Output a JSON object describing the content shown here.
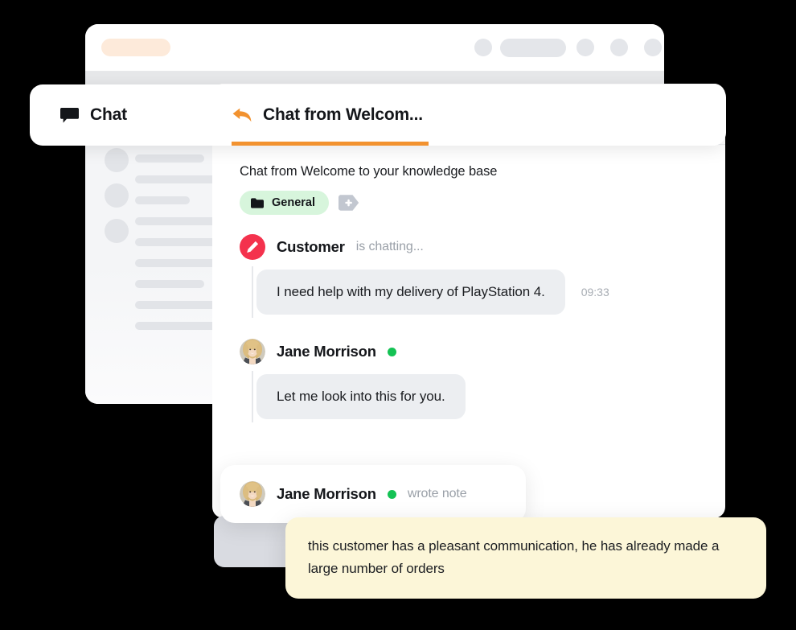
{
  "window": {
    "topbar": {
      "brand_pill": "",
      "nav_dots": [
        "",
        "",
        "",
        ""
      ],
      "nav_pill": ""
    },
    "sidebar": {
      "skeleton_items": 4
    }
  },
  "chat_card": {
    "icon": "chat-balloon-icon",
    "label": "Chat"
  },
  "tab": {
    "icon": "reply-arrow-icon",
    "label": "Chat from Welcom...",
    "accent_color": "#F2922F"
  },
  "conversation": {
    "subject": "Chat from Welcome to your knowledge base",
    "tag": {
      "icon": "folder-icon",
      "label": "General",
      "background_color": "#D7F5DC"
    },
    "add_tag": {
      "icon": "tag-plus-icon",
      "label": "+"
    }
  },
  "messages": [
    {
      "author": "Customer",
      "status_text": "is chatting...",
      "avatar": "pencil-icon",
      "avatar_color": "#F4324D",
      "online": false,
      "text": "I need help with my delivery of PlayStation 4.",
      "time": "09:33"
    },
    {
      "author": "Jane Morrison",
      "status_text": "",
      "avatar": "photo-avatar",
      "online": true,
      "online_color": "#14C254",
      "text": "Let me look into this for you.",
      "time": ""
    }
  ],
  "note": {
    "author": "Jane Morrison",
    "online": true,
    "action": "wrote note",
    "text": "this customer has a pleasant communication, he has already made a large number of orders",
    "background_color": "#FCF6D8"
  }
}
